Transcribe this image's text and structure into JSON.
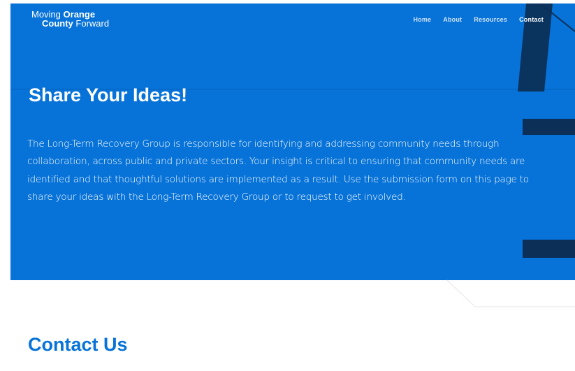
{
  "header": {
    "logo": {
      "line1_regular": "Moving ",
      "line1_bold": "Orange",
      "line2_bold": "County",
      "line2_regular": " Forward"
    },
    "nav": [
      {
        "label": "Home"
      },
      {
        "label": "About"
      },
      {
        "label": "Resources"
      },
      {
        "label": "Contact"
      }
    ]
  },
  "hero": {
    "title": "Share Your Ideas!",
    "body": "The Long-Term Recovery Group is responsible for identifying and addressing community needs through collaboration, across public and private sectors. Your insight is critical to ensuring that community needs are identified and that thoughtful solutions are implemented as a result. Use the submission form on this page to share your ideas with the Long-Term Recovery Group or to request to get involved."
  },
  "contact": {
    "title": "Contact Us"
  },
  "colors": {
    "brand_blue": "#0773d8",
    "dark_navy": "#0b2f57",
    "white": "#ffffff"
  }
}
